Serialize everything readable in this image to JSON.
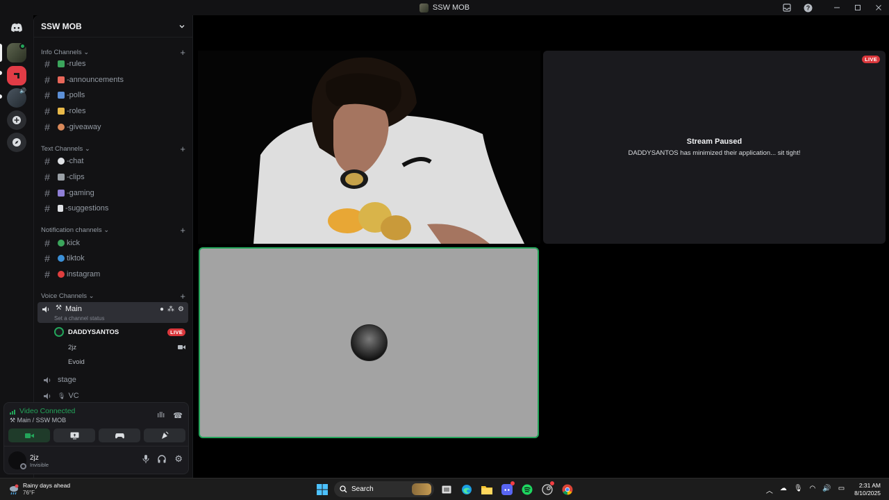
{
  "window": {
    "title": "SSW MOB"
  },
  "server": {
    "name": "SSW MOB"
  },
  "categories": [
    {
      "label": "Info Channels",
      "channels": [
        {
          "label": "-rules",
          "emoji_color": "#3ba55c"
        },
        {
          "label": "-announcements",
          "emoji_color": "#e8675a"
        },
        {
          "label": "-polls",
          "emoji_color": "#5c8fd6"
        },
        {
          "label": "-roles",
          "emoji_color": "#e9b949"
        },
        {
          "label": "-giveaway",
          "emoji_color": "#d9895a"
        }
      ]
    },
    {
      "label": "Text Channels",
      "channels": [
        {
          "label": "-chat",
          "emoji_color": "#dfe1e5"
        },
        {
          "label": "-clips",
          "emoji_color": "#9aa0a6"
        },
        {
          "label": "-gaming",
          "emoji_color": "#8f7fd6"
        },
        {
          "label": "-suggestions",
          "emoji_color": "#dfe1e5"
        }
      ]
    },
    {
      "label": "Notification channels",
      "channels": [
        {
          "label": "kick",
          "emoji_color": "#3ba55c"
        },
        {
          "label": "tiktok",
          "emoji_color": "#3b8fd6"
        },
        {
          "label": "instagram",
          "emoji_color": "#e03e3e"
        }
      ]
    },
    {
      "label": "Voice Channels",
      "channels": []
    }
  ],
  "voice": {
    "main": {
      "label": "Main",
      "status": "Set a channel status"
    },
    "users": [
      {
        "name": "DADDYSANTOS",
        "badge": "LIVE"
      },
      {
        "name": "2jz"
      },
      {
        "name": "Evoid"
      }
    ],
    "others": [
      {
        "label": "stage"
      },
      {
        "label": "VC"
      }
    ]
  },
  "voice_panel": {
    "status": "Video Connected",
    "location": "Main / SSW MOB"
  },
  "user": {
    "name": "2jz",
    "status": "Invisible"
  },
  "stage": {
    "paused_badge": "LIVE",
    "paused_title": "Stream Paused",
    "paused_desc": "DADDYSANTOS has minimized their application... sit tight!"
  },
  "taskbar": {
    "weather_title": "Rainy days ahead",
    "weather_temp": "76°F",
    "search": "Search",
    "time": "2:31 AM",
    "date": "8/10/2025"
  },
  "colors": {
    "accent_green": "#23a55a",
    "live_red": "#da373c"
  }
}
